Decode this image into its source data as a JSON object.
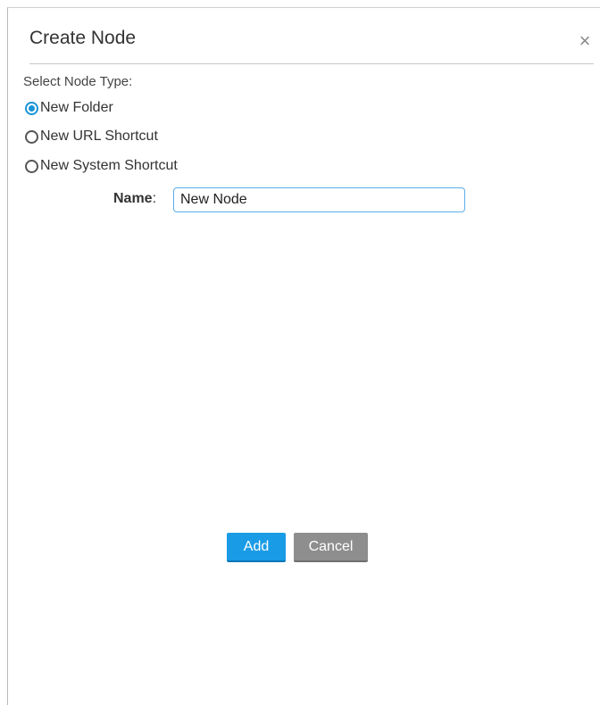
{
  "dialog": {
    "title": "Create Node",
    "close_glyph": "×",
    "close_icon": "close-icon"
  },
  "form": {
    "section_label": "Select Node Type:",
    "node_types": [
      {
        "label": "New Folder",
        "selected": true
      },
      {
        "label": "New URL Shortcut",
        "selected": false
      },
      {
        "label": "New System Shortcut",
        "selected": false
      }
    ],
    "name_label": "Name",
    "name_colon": ":",
    "name_value": "New Node"
  },
  "buttons": {
    "add_label": "Add",
    "cancel_label": "Cancel"
  },
  "colors": {
    "accent": "#1a9be6",
    "radio_selected": "#1a94d8",
    "cancel_gray": "#8e8e8e"
  }
}
